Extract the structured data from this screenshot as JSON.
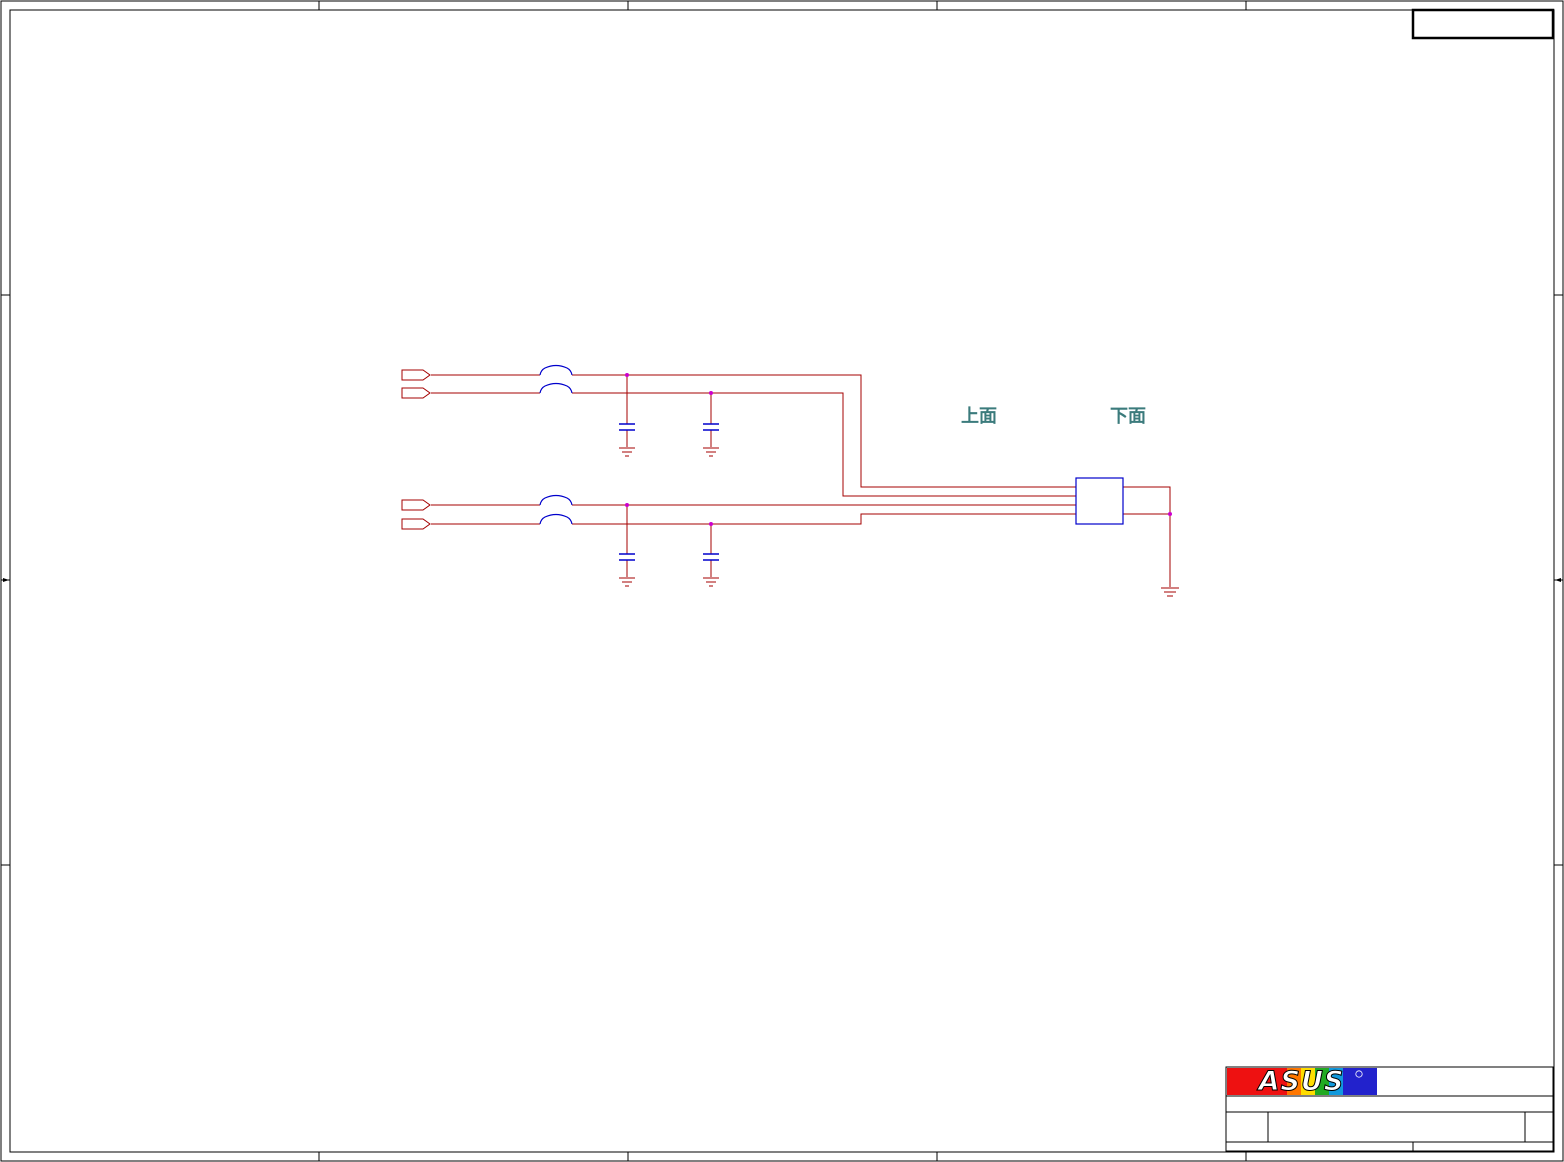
{
  "labels": {
    "top_side": "上面",
    "bottom_side": "下面"
  },
  "title_block": {
    "logo_text": "ASUS"
  },
  "colors": {
    "border": "#000000",
    "wire": "#a40000",
    "component": "#0000cc",
    "junction": "#cc00cc",
    "label_text": "#3b7b7c"
  }
}
